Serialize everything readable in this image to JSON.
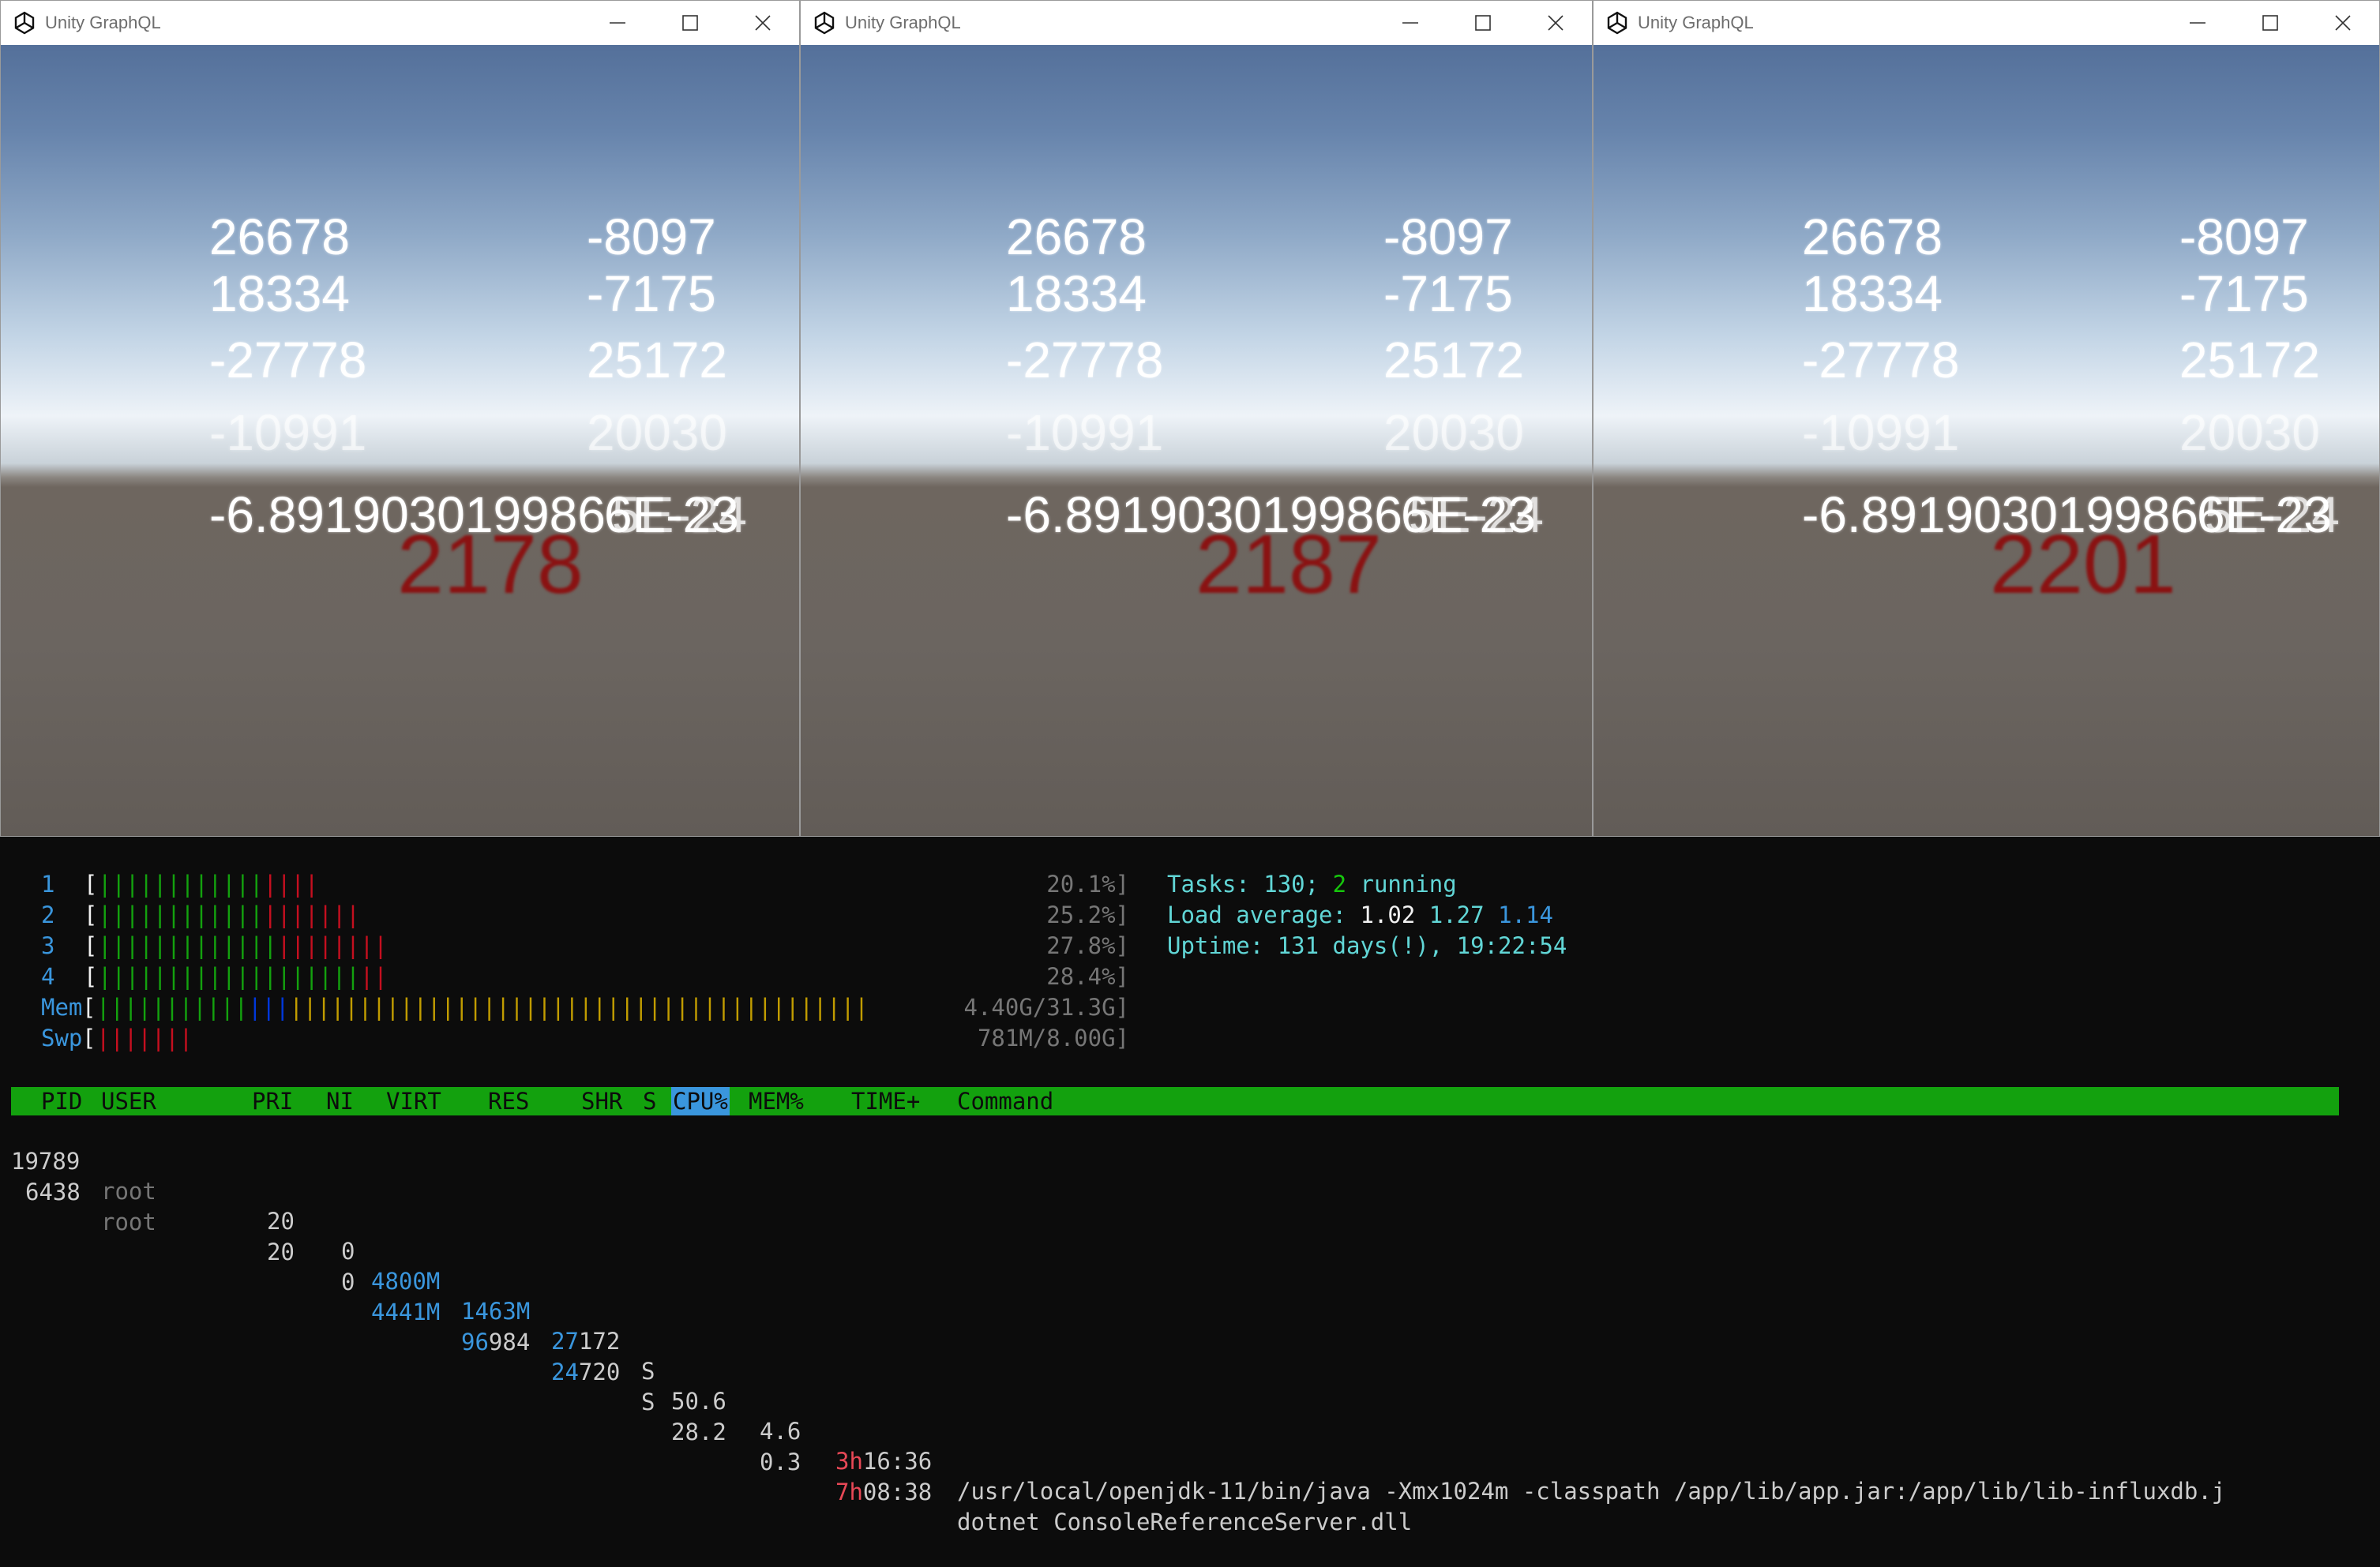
{
  "windows": [
    {
      "title": "Unity GraphQL",
      "left_values": [
        "26678",
        "18334",
        "-27778",
        "-10991"
      ],
      "right_values": [
        "-8097",
        "-7175",
        "25172",
        "20030"
      ],
      "overlap_text": "-6.891903019986",
      "overlap_suffix_a": "6E-23",
      "overlap_suffix_b": "5E-24",
      "counter": "2178"
    },
    {
      "title": "Unity GraphQL",
      "left_values": [
        "26678",
        "18334",
        "-27778",
        "-10991"
      ],
      "right_values": [
        "-8097",
        "-7175",
        "25172",
        "20030"
      ],
      "overlap_text": "-6.891903019986",
      "overlap_suffix_a": "6E-23",
      "overlap_suffix_b": "5E-24",
      "counter": "2187"
    },
    {
      "title": "Unity GraphQL",
      "left_values": [
        "26678",
        "18334",
        "-27778",
        "-10991"
      ],
      "right_values": [
        "-8097",
        "-7175",
        "25172",
        "20030"
      ],
      "overlap_text": "-6.891903019986",
      "overlap_suffix_a": "6E-23",
      "overlap_suffix_b": "5E-24",
      "counter": "2201"
    }
  ],
  "window_controls": {
    "minimize_icon": "minimize-icon",
    "maximize_icon": "maximize-icon",
    "close_icon": "close-icon"
  },
  "htop": {
    "meters": [
      {
        "label": "1",
        "green": 12,
        "blue": 0,
        "yellow": 0,
        "red": 4,
        "text": "20.1%]"
      },
      {
        "label": "2",
        "green": 12,
        "blue": 0,
        "yellow": 0,
        "red": 7,
        "text": "25.2%]"
      },
      {
        "label": "3",
        "green": 13,
        "blue": 0,
        "yellow": 0,
        "red": 8,
        "text": "27.8%]"
      },
      {
        "label": "4",
        "green": 19,
        "blue": 0,
        "yellow": 0,
        "red": 2,
        "text": "28.4%]"
      },
      {
        "label": "Mem",
        "green": 11,
        "blue": 3,
        "yellow": 42,
        "red": 0,
        "text": "4.40G/31.3G]"
      },
      {
        "label": "Swp",
        "green": 0,
        "blue": 0,
        "yellow": 0,
        "red": 7,
        "text": "781M/8.00G]"
      }
    ],
    "tasks_label": "Tasks:",
    "tasks_count": "130",
    "tasks_sep": ";",
    "running_count": "2",
    "running_label": "running",
    "load_label": "Load average:",
    "load_1": "1.02",
    "load_5": "1.27",
    "load_15": "1.14",
    "uptime_label": "Uptime:",
    "uptime_value": "131 days(!), 19:22:54",
    "columns": [
      "PID",
      "USER",
      "PRI",
      "NI",
      "VIRT",
      "RES",
      "SHR",
      "S",
      "CPU%",
      "MEM%",
      "TIME+",
      "Command"
    ],
    "processes": [
      {
        "pid": "19789",
        "user": "root",
        "pri": "20",
        "ni": "0",
        "virt": "4800M",
        "res": "1463M",
        "shr_hi": "27",
        "shr_lo": "172",
        "s": "S",
        "cpu": "50.6",
        "mem": "4.6",
        "time_hi": "3h",
        "time_lo": "16:36",
        "command": "/usr/local/openjdk-11/bin/java -Xmx1024m -classpath /app/lib/app.jar:/app/lib/lib-influxdb.j"
      },
      {
        "pid": "6438",
        "user": "root",
        "pri": "20",
        "ni": "0",
        "virt": "4441M",
        "res_hi": "96",
        "res_lo": "984",
        "shr_hi": "24",
        "shr_lo": "720",
        "s": "S",
        "cpu": "28.2",
        "mem": "0.3",
        "time_hi": "7h",
        "time_lo": "08:38",
        "command": "dotnet ConsoleReferenceServer.dll"
      }
    ]
  }
}
